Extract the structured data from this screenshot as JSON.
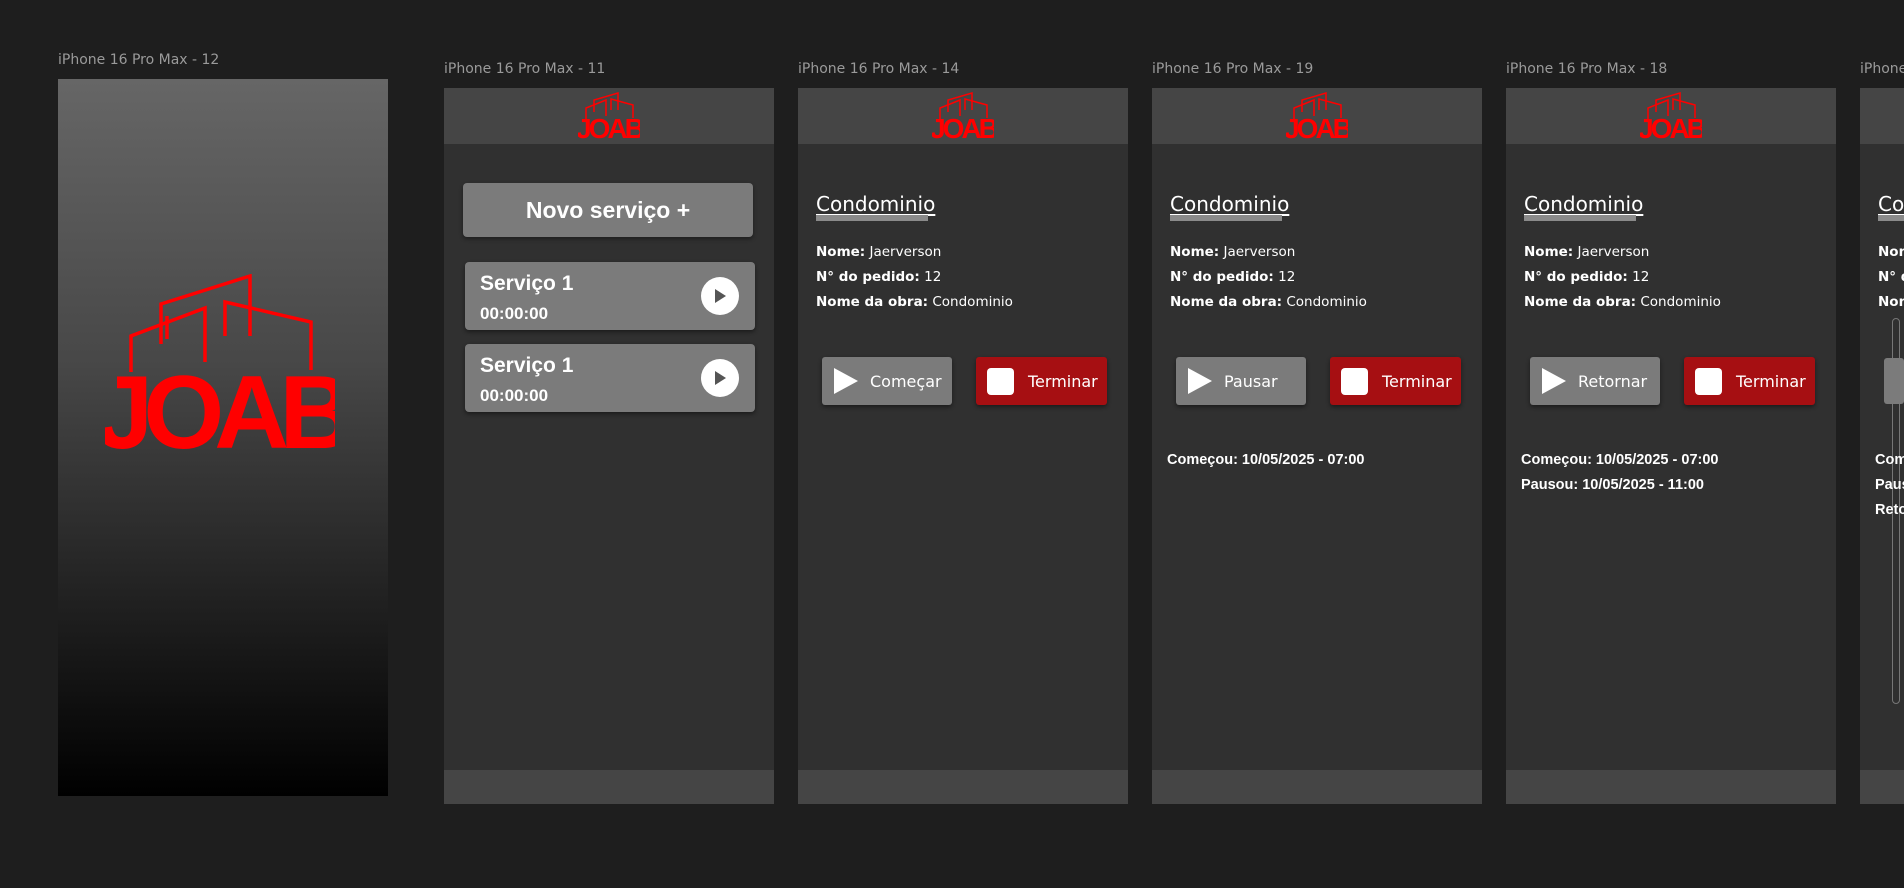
{
  "brand": {
    "logo_text": "JOAB",
    "color": "#ff0000"
  },
  "frames": [
    {
      "label": "iPhone 16 Pro Max - 12"
    },
    {
      "label": "iPhone 16 Pro Max - 11"
    },
    {
      "label": "iPhone 16 Pro Max - 14"
    },
    {
      "label": "iPhone 16 Pro Max - 19"
    },
    {
      "label": "iPhone 16 Pro Max - 18"
    },
    {
      "label": "iPhone"
    }
  ],
  "service_list": {
    "new_service_label": "Novo serviço +",
    "services": [
      {
        "title": "Serviço 1",
        "timer": "00:00:00",
        "icon": "play-icon"
      },
      {
        "title": "Serviço 1",
        "timer": "00:00:00",
        "icon": "play-icon"
      }
    ]
  },
  "detail": {
    "title": "Condominio",
    "name_label": "Nome:",
    "name_value": "Jaerverson",
    "order_label": "N° do pedido:",
    "order_value": "12",
    "work_label": "Nome da obra:",
    "work_value": "Condominio"
  },
  "screen14": {
    "primary_label": "Começar",
    "stop_label": "Terminar"
  },
  "screen19": {
    "primary_label": "Pausar",
    "stop_label": "Terminar",
    "log": [
      "Começou: 10/05/2025 - 07:00"
    ]
  },
  "screen18": {
    "primary_label": "Retornar",
    "stop_label": "Terminar",
    "log": [
      "Começou: 10/05/2025 - 07:00",
      "Pausou: 10/05/2025 - 11:00"
    ]
  },
  "screen_partial": {
    "title": "Co",
    "name_label": "Nom",
    "order_label": "N° d",
    "work_label": "Nom",
    "log": [
      "Com",
      "Paus",
      "Reto"
    ]
  },
  "colors": {
    "background": "#1e1e1e",
    "screen": "#303030",
    "bar": "#454545",
    "button_gray": "#7b7b7b",
    "button_red": "#a60f12"
  }
}
